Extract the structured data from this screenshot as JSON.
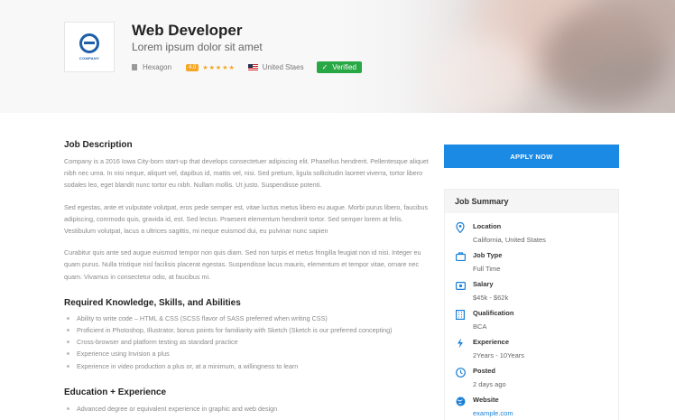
{
  "header": {
    "logo_text": "COMPANY",
    "title": "Web Developer",
    "subtitle": "Lorem ipsum dolor sit amet",
    "company": "Hexagon",
    "rating": "4.0",
    "stars": "★★★★★",
    "location": "United Staes",
    "verified": "Verified"
  },
  "colors": {
    "accent": "#1a8ae5",
    "verified": "#28a745",
    "rating": "#f5a623"
  },
  "main": {
    "job_description_title": "Job Description",
    "paragraphs": [
      "Company is a 2016 Iowa City-born start-up that develops consectetuer adipiscing elit. Phasellus hendrerit. Pellentesque aliquet nibh nec urna. In nisi neque, aliquet vel, dapibus id, mattis vel, nisi. Sed pretium, ligula sollicitudin laoreet viverra, tortor libero sodales leo, eget blandit nunc tortor eu nibh. Nullam mollis. Ut justo. Suspendisse potenti.",
      "Sed egestas, ante et vulputate volutpat, eros pede semper est, vitae luctus metus libero eu augue. Morbi purus libero, faucibus adipiscing, commodo quis, gravida id, est. Sed lectus. Praesent elementum hendrerit tortor. Sed semper lorem at felis. Vestibulum volutpat, lacus a ultrices sagittis, mi neque euismod dui, eu pulvinar nunc sapien",
      "Curabitur quis ante sed augue euismod tempor non quis diam. Sed non turpis et metus fringilla feugiat non id nisi. Integer eu quam purus. Nulla tristique nisl facilisis placerat egestas. Suspendisse lacus mauris, elementum et tempor vitae, ornare nec quam. Vivamus in consectetur odio, at faucibus mi."
    ],
    "skills_title": "Required Knowledge, Skills, and Abilities",
    "skills": [
      "Ability to write code – HTML & CSS (SCSS flavor of SASS preferred when writing CSS)",
      "Proficient in Photoshop, Illustrator, bonus points for familiarity with Sketch (Sketch is our preferred concepting)",
      "Cross-browser and platform testing as standard practice",
      "Experience using Invision a plus",
      "Experience in video production a plus or, at a minimum, a willingness to learn"
    ],
    "education_title": "Education + Experience",
    "education_first": "Advanced degree or equivalent experience in graphic and web design"
  },
  "sidebar": {
    "apply_label": "APPLY NOW",
    "summary_title": "Job Summary",
    "items": [
      {
        "label": "Location",
        "value": "California, United States",
        "icon": "map-pin-icon"
      },
      {
        "label": "Job Type",
        "value": "Full Time",
        "icon": "briefcase-icon"
      },
      {
        "label": "Salary",
        "value": "$45k - $62k",
        "icon": "money-icon"
      },
      {
        "label": "Qualification",
        "value": "BCA",
        "icon": "building-icon"
      },
      {
        "label": "Experience",
        "value": "2Years - 10Years",
        "icon": "lightning-icon"
      },
      {
        "label": "Posted",
        "value": "2 days ago",
        "icon": "clock-icon"
      },
      {
        "label": "Website",
        "value": "example.com",
        "icon": "globe-icon"
      }
    ]
  }
}
